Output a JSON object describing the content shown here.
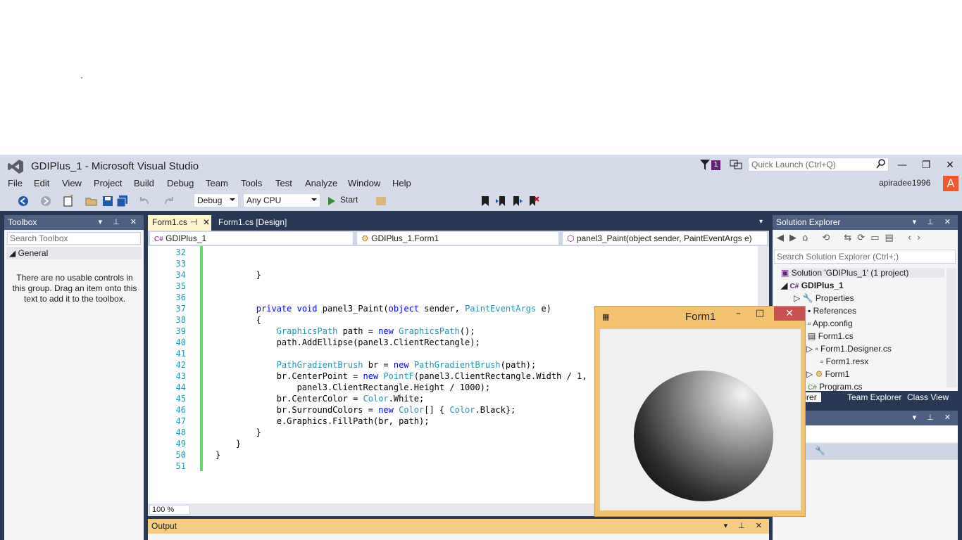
{
  "window": {
    "title": "GDIPlus_1 - Microsoft Visual Studio",
    "notification_count": "1",
    "quick_launch_placeholder": "Quick Launch (Ctrl+Q)",
    "user": "apiradee1996",
    "user_initial": "A"
  },
  "menu": [
    "File",
    "Edit",
    "View",
    "Project",
    "Build",
    "Debug",
    "Team",
    "Tools",
    "Test",
    "Analyze",
    "Window",
    "Help"
  ],
  "toolbar": {
    "configuration": "Debug",
    "platform": "Any CPU",
    "start_label": "Start"
  },
  "toolbox": {
    "title": "Toolbox",
    "search_placeholder": "Search Toolbox",
    "group": "General",
    "empty_message": "There are no usable controls in this group. Drag an item onto this text to add it to the toolbox."
  },
  "editor": {
    "tabs": [
      "Form1.cs",
      "Form1.cs [Design]"
    ],
    "nav": {
      "project": "GDIPlus_1",
      "class": "GDIPlus_1.Form1",
      "member": "panel3_Paint(object sender, PaintEventArgs e)"
    },
    "lines": [
      {
        "n": "32",
        "t": ""
      },
      {
        "n": "33",
        "t": ""
      },
      {
        "n": "34",
        "t": "        }"
      },
      {
        "n": "35",
        "t": ""
      },
      {
        "n": "36",
        "t": ""
      },
      {
        "n": "37",
        "t": "        private void panel3_Paint(object sender, PaintEventArgs e)"
      },
      {
        "n": "38",
        "t": "        {"
      },
      {
        "n": "39",
        "t": "            GraphicsPath path = new GraphicsPath();"
      },
      {
        "n": "40",
        "t": "            path.AddEllipse(panel3.ClientRectangle);"
      },
      {
        "n": "41",
        "t": ""
      },
      {
        "n": "42",
        "t": "            PathGradientBrush br = new PathGradientBrush(path);"
      },
      {
        "n": "43",
        "t": "            br.CenterPoint = new PointF(panel3.ClientRectangle.Width / 1,"
      },
      {
        "n": "44",
        "t": "                panel3.ClientRectangle.Height / 1000);"
      },
      {
        "n": "45",
        "t": "            br.CenterColor = Color.White;"
      },
      {
        "n": "46",
        "t": "            br.SurroundColors = new Color[] { Color.Black};"
      },
      {
        "n": "47",
        "t": "            e.Graphics.FillPath(br, path);"
      },
      {
        "n": "48",
        "t": "        }"
      },
      {
        "n": "49",
        "t": "    }"
      },
      {
        "n": "50",
        "t": "}"
      },
      {
        "n": "51",
        "t": ""
      }
    ],
    "zoom": "100 %"
  },
  "output": {
    "title": "Output"
  },
  "solution_explorer": {
    "title": "Solution Explorer",
    "search_placeholder": "Search Solution Explorer (Ctrl+;)",
    "items": [
      "Solution 'GDIPlus_1' (1 project)",
      "GDIPlus_1",
      "Properties",
      "References",
      "App.config",
      "Form1.cs",
      "Form1.Designer.cs",
      "Form1.resx",
      "Form1",
      "Program.cs"
    ],
    "tabs": [
      "n Explorer",
      "Team Explorer",
      "Class View"
    ]
  },
  "properties": {
    "title_fragment": "es"
  },
  "form1": {
    "title": "Form1"
  }
}
